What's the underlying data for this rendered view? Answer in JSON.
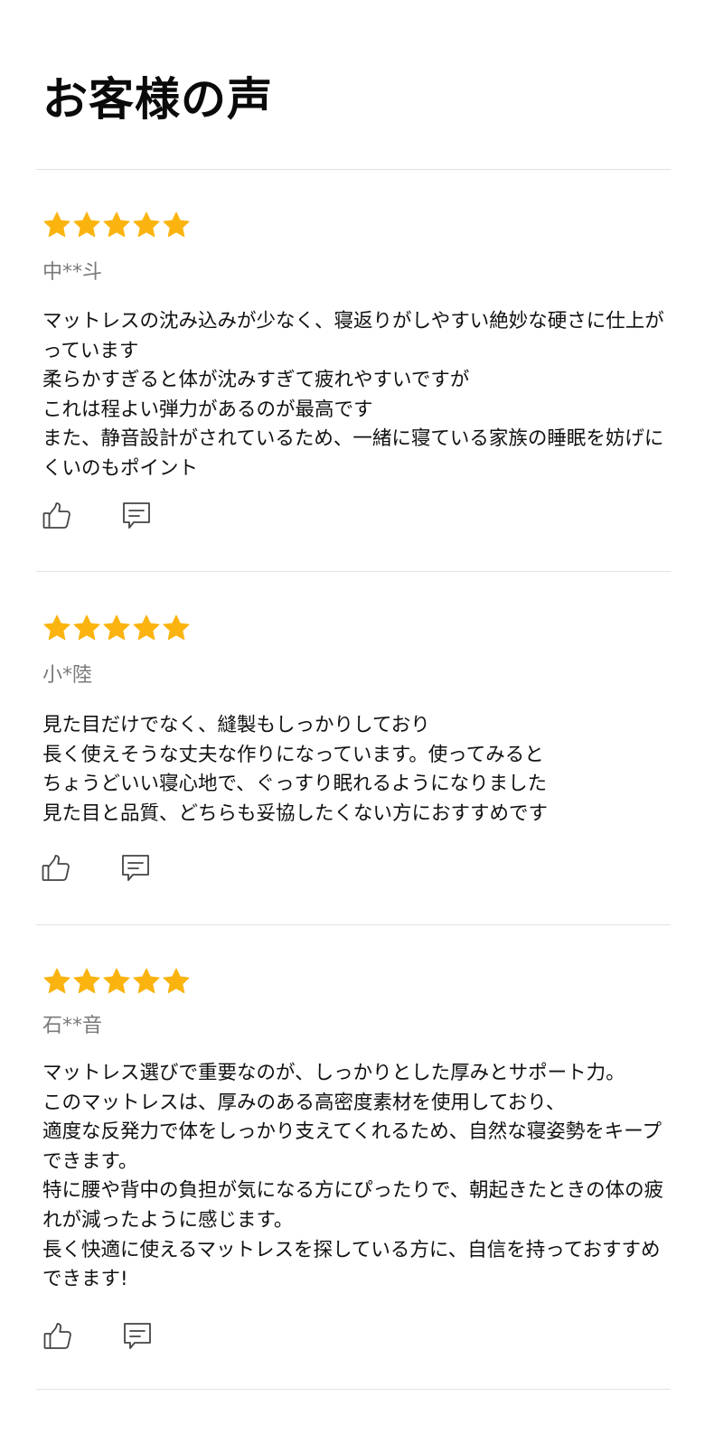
{
  "page": {
    "title": "お客様の声"
  },
  "colors": {
    "star": "#FBB40F",
    "divider": "#E2E2E2",
    "reviewer_name": "#7A7A7A",
    "text": "#111111",
    "icon": "#444444"
  },
  "reviews": [
    {
      "rating": 5,
      "reviewer": "中**斗",
      "text": "マットレスの沈み込みが少なく、寝返りがしやすい絶妙な硬さに仕上がっています\n柔らかすぎると体が沈みすぎて疲れやすいですが\nこれは程よい弾力があるのが最高です\nまた、静音設計がされているため、一緒に寝ている家族の睡眠を妨げにくいのもポイント",
      "icons": [
        "thumbs-up-icon",
        "comment-icon"
      ]
    },
    {
      "rating": 5,
      "reviewer": "小*陸",
      "text": "見た目だけでなく、縫製もしっかりしており\n長く使えそうな丈夫な作りになっています。使ってみると\nちょうどいい寝心地で、ぐっすり眠れるようになりました\n見た目と品質、どちらも妥協したくない方におすすめです",
      "icons": [
        "thumbs-up-icon",
        "comment-icon"
      ]
    },
    {
      "rating": 5,
      "reviewer": "石**音",
      "text": "マットレス選びで重要なのが、しっかりとした厚みとサポート力。\nこのマットレスは、厚みのある高密度素材を使用しており、\n適度な反発力で体をしっかり支えてくれるため、自然な寝姿勢をキープできます。\n特に腰や背中の負担が気になる方にぴったりで、朝起きたときの体の疲れが減ったように感じます。\n長く快適に使えるマットレスを探している方に、自信を持っておすすめできます!",
      "icons": [
        "thumbs-up-icon",
        "comment-icon"
      ]
    }
  ]
}
